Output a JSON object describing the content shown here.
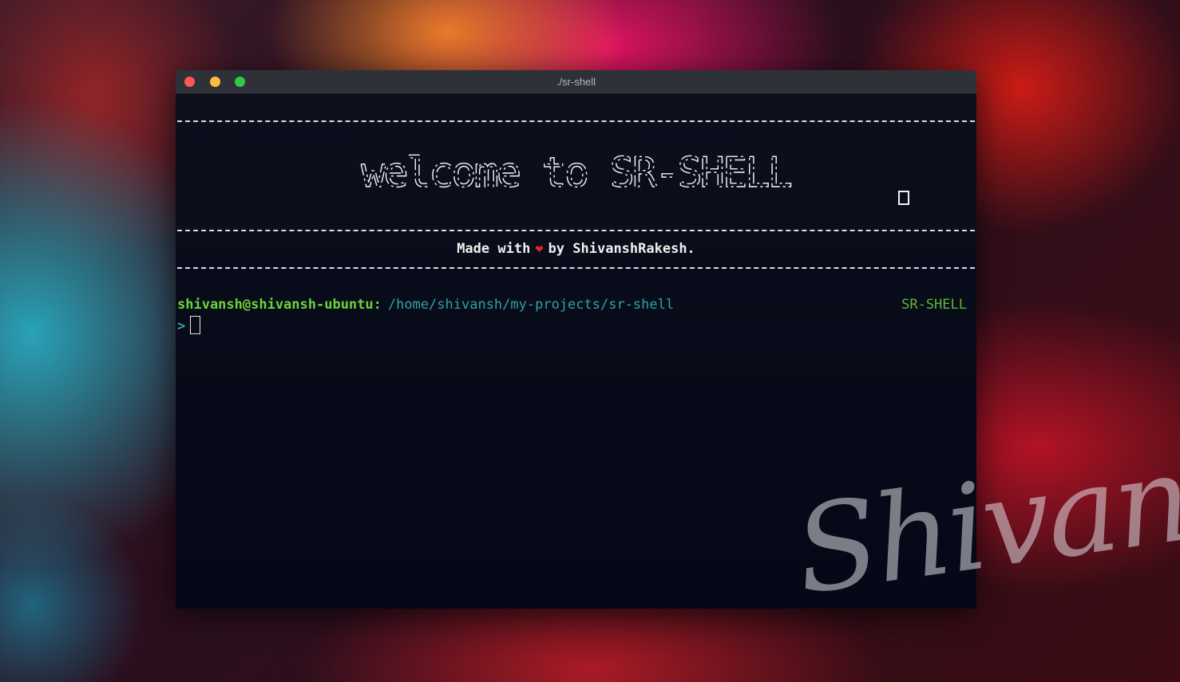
{
  "window": {
    "title": "./sr-shell"
  },
  "banner": {
    "text": "welcome to SR-SHELL"
  },
  "credit": {
    "prefix": "Made with",
    "heart": "❤",
    "suffix": "by ShivanshRakesh."
  },
  "prompt": {
    "user_host": "shivansh@shivansh-ubuntu:",
    "cwd": "/home/shivansh/my-projects/sr-shell",
    "app_name": "SR-SHELL",
    "arrow": ">"
  },
  "watermark": {
    "text": "Shivansh"
  },
  "colors": {
    "user_host": "#6bd33c",
    "cwd": "#2fa3a8",
    "app_name": "#5cb538",
    "heart": "#e0232d"
  }
}
